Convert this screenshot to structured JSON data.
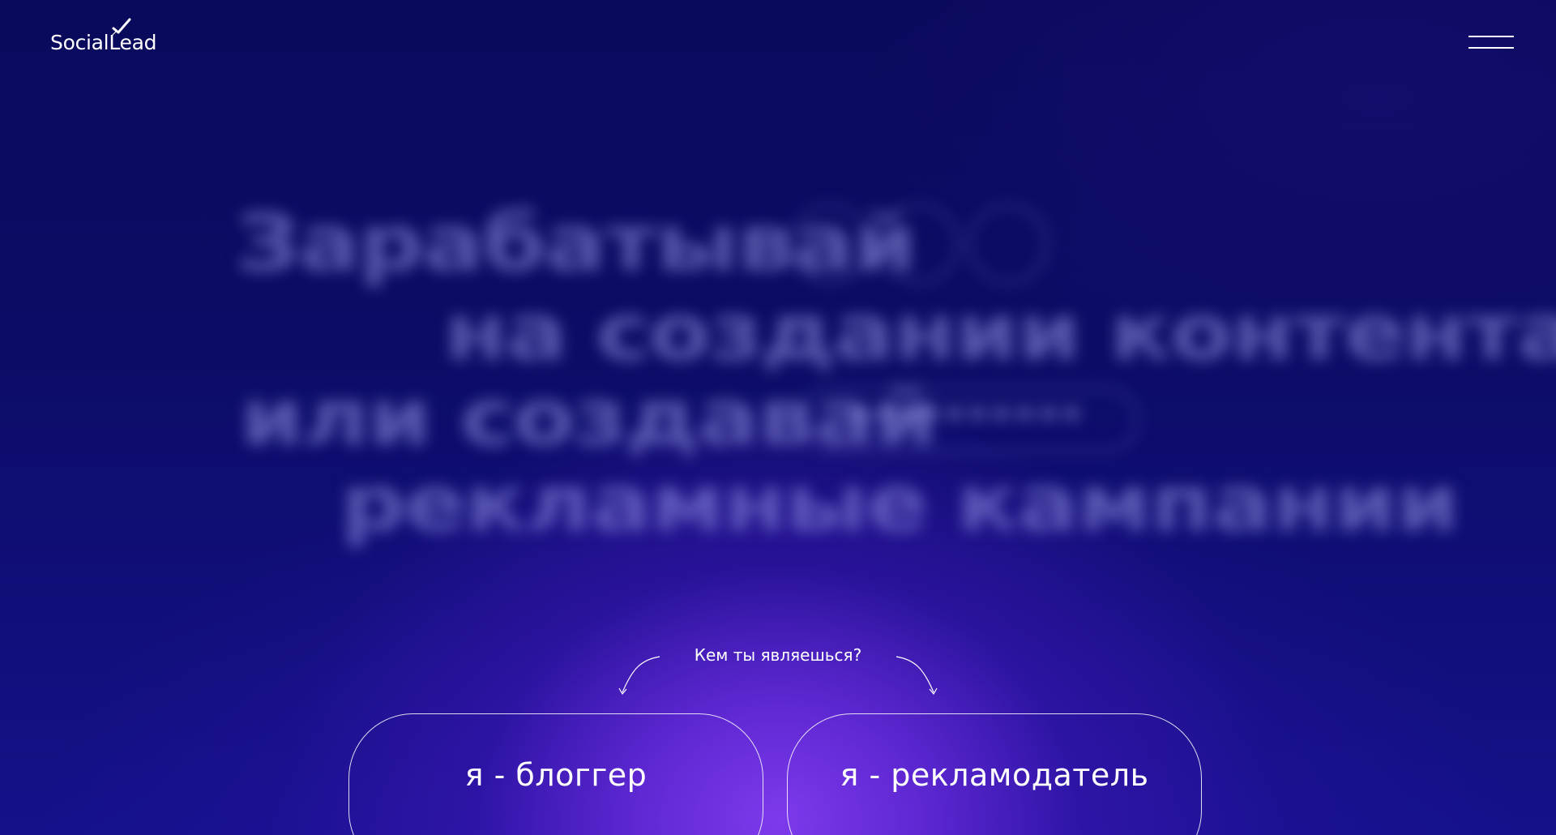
{
  "header": {
    "logo_text": "SocialLead",
    "logo_icon": "check-icon",
    "menu_icon": "hamburger-menu-icon"
  },
  "hero": {
    "line1": "Зарабатывай",
    "line2": "на создании контента",
    "line3": "или создавай",
    "line4": "рекламные кампании",
    "pill_text": "**********"
  },
  "role_select": {
    "question": "Кем ты являешься?",
    "blogger_label": "я - блоггер",
    "advertiser_label": "я - рекламодатель"
  },
  "colors": {
    "background_dark": "#0a0a5c",
    "accent_glow": "#7a3ae8",
    "text": "#ffffff"
  }
}
